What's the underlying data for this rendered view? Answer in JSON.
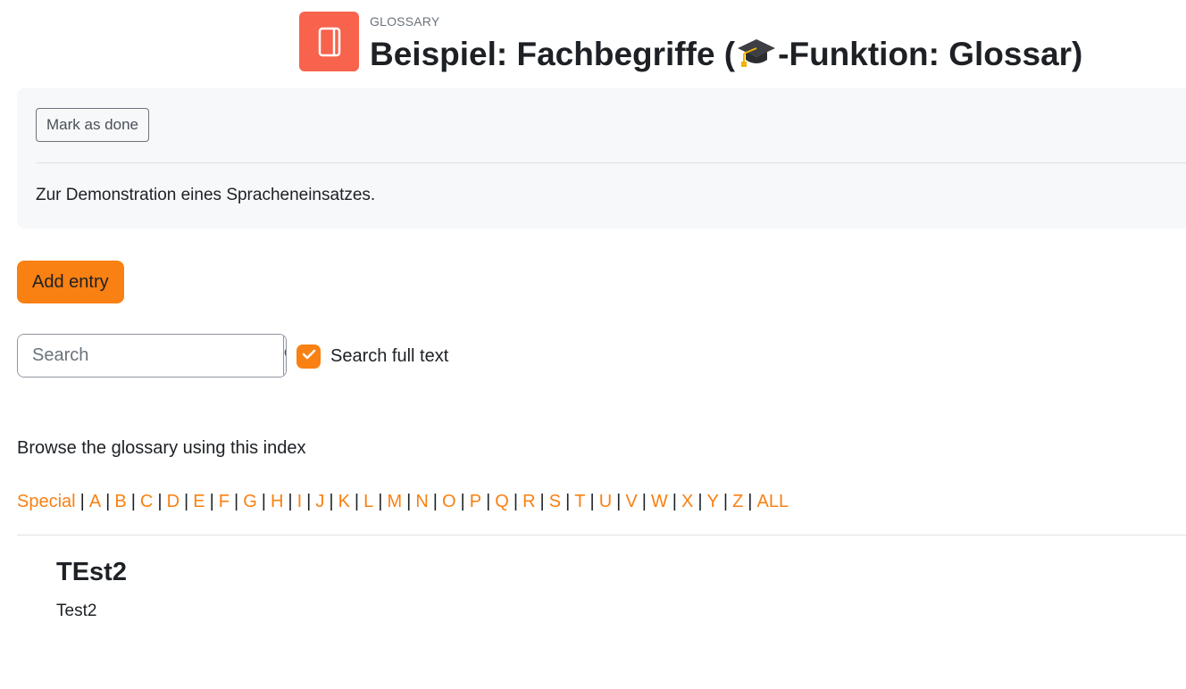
{
  "header": {
    "activity_label": "GLOSSARY",
    "title_before": "Beispiel: Fachbegriffe (",
    "title_after": "-Funktion: Glossar)",
    "title_icon": "graduation-cap-emoji",
    "activity_icon": "glossary-book-icon",
    "activity_icon_color": "#f7634d"
  },
  "info": {
    "mark_done_label": "Mark as done",
    "description": "Zur Demonstration eines Spracheneinsatzes."
  },
  "actions": {
    "add_entry_label": "Add entry",
    "accent_color": "#f98012"
  },
  "search": {
    "placeholder": "Search",
    "value": "",
    "fulltext_label": "Search full text",
    "fulltext_checked": true
  },
  "browse": {
    "prompt": "Browse the glossary using this index",
    "letters": [
      "Special",
      "A",
      "B",
      "C",
      "D",
      "E",
      "F",
      "G",
      "H",
      "I",
      "J",
      "K",
      "L",
      "M",
      "N",
      "O",
      "P",
      "Q",
      "R",
      "S",
      "T",
      "U",
      "V",
      "W",
      "X",
      "Y",
      "Z",
      "ALL"
    ]
  },
  "entries": [
    {
      "term": "TEst2",
      "definition": "Test2"
    }
  ]
}
